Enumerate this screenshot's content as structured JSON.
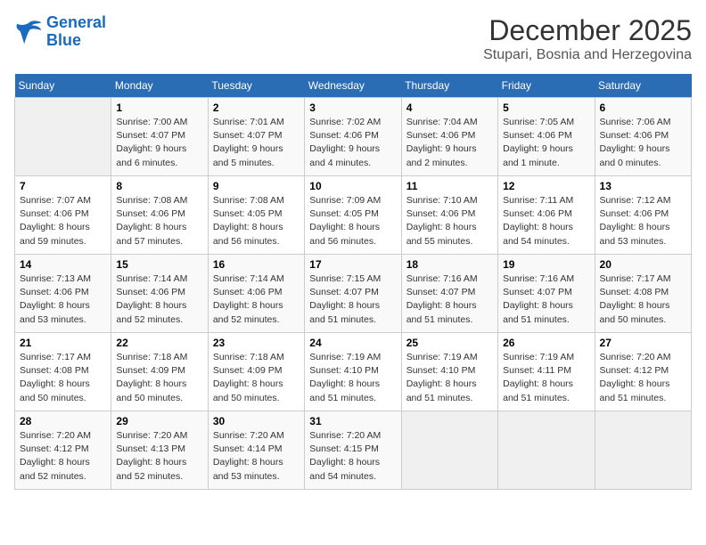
{
  "header": {
    "logo_line1": "General",
    "logo_line2": "Blue",
    "month_title": "December 2025",
    "location": "Stupari, Bosnia and Herzegovina"
  },
  "days_of_week": [
    "Sunday",
    "Monday",
    "Tuesday",
    "Wednesday",
    "Thursday",
    "Friday",
    "Saturday"
  ],
  "weeks": [
    [
      {
        "num": "",
        "empty": true
      },
      {
        "num": "1",
        "sunrise": "7:00 AM",
        "sunset": "4:07 PM",
        "daylight": "9 hours and 6 minutes."
      },
      {
        "num": "2",
        "sunrise": "7:01 AM",
        "sunset": "4:07 PM",
        "daylight": "9 hours and 5 minutes."
      },
      {
        "num": "3",
        "sunrise": "7:02 AM",
        "sunset": "4:06 PM",
        "daylight": "9 hours and 4 minutes."
      },
      {
        "num": "4",
        "sunrise": "7:04 AM",
        "sunset": "4:06 PM",
        "daylight": "9 hours and 2 minutes."
      },
      {
        "num": "5",
        "sunrise": "7:05 AM",
        "sunset": "4:06 PM",
        "daylight": "9 hours and 1 minute."
      },
      {
        "num": "6",
        "sunrise": "7:06 AM",
        "sunset": "4:06 PM",
        "daylight": "9 hours and 0 minutes."
      }
    ],
    [
      {
        "num": "7",
        "sunrise": "7:07 AM",
        "sunset": "4:06 PM",
        "daylight": "8 hours and 59 minutes."
      },
      {
        "num": "8",
        "sunrise": "7:08 AM",
        "sunset": "4:06 PM",
        "daylight": "8 hours and 57 minutes."
      },
      {
        "num": "9",
        "sunrise": "7:08 AM",
        "sunset": "4:05 PM",
        "daylight": "8 hours and 56 minutes."
      },
      {
        "num": "10",
        "sunrise": "7:09 AM",
        "sunset": "4:05 PM",
        "daylight": "8 hours and 56 minutes."
      },
      {
        "num": "11",
        "sunrise": "7:10 AM",
        "sunset": "4:06 PM",
        "daylight": "8 hours and 55 minutes."
      },
      {
        "num": "12",
        "sunrise": "7:11 AM",
        "sunset": "4:06 PM",
        "daylight": "8 hours and 54 minutes."
      },
      {
        "num": "13",
        "sunrise": "7:12 AM",
        "sunset": "4:06 PM",
        "daylight": "8 hours and 53 minutes."
      }
    ],
    [
      {
        "num": "14",
        "sunrise": "7:13 AM",
        "sunset": "4:06 PM",
        "daylight": "8 hours and 53 minutes."
      },
      {
        "num": "15",
        "sunrise": "7:14 AM",
        "sunset": "4:06 PM",
        "daylight": "8 hours and 52 minutes."
      },
      {
        "num": "16",
        "sunrise": "7:14 AM",
        "sunset": "4:06 PM",
        "daylight": "8 hours and 52 minutes."
      },
      {
        "num": "17",
        "sunrise": "7:15 AM",
        "sunset": "4:07 PM",
        "daylight": "8 hours and 51 minutes."
      },
      {
        "num": "18",
        "sunrise": "7:16 AM",
        "sunset": "4:07 PM",
        "daylight": "8 hours and 51 minutes."
      },
      {
        "num": "19",
        "sunrise": "7:16 AM",
        "sunset": "4:07 PM",
        "daylight": "8 hours and 51 minutes."
      },
      {
        "num": "20",
        "sunrise": "7:17 AM",
        "sunset": "4:08 PM",
        "daylight": "8 hours and 50 minutes."
      }
    ],
    [
      {
        "num": "21",
        "sunrise": "7:17 AM",
        "sunset": "4:08 PM",
        "daylight": "8 hours and 50 minutes."
      },
      {
        "num": "22",
        "sunrise": "7:18 AM",
        "sunset": "4:09 PM",
        "daylight": "8 hours and 50 minutes."
      },
      {
        "num": "23",
        "sunrise": "7:18 AM",
        "sunset": "4:09 PM",
        "daylight": "8 hours and 50 minutes."
      },
      {
        "num": "24",
        "sunrise": "7:19 AM",
        "sunset": "4:10 PM",
        "daylight": "8 hours and 51 minutes."
      },
      {
        "num": "25",
        "sunrise": "7:19 AM",
        "sunset": "4:10 PM",
        "daylight": "8 hours and 51 minutes."
      },
      {
        "num": "26",
        "sunrise": "7:19 AM",
        "sunset": "4:11 PM",
        "daylight": "8 hours and 51 minutes."
      },
      {
        "num": "27",
        "sunrise": "7:20 AM",
        "sunset": "4:12 PM",
        "daylight": "8 hours and 51 minutes."
      }
    ],
    [
      {
        "num": "28",
        "sunrise": "7:20 AM",
        "sunset": "4:12 PM",
        "daylight": "8 hours and 52 minutes."
      },
      {
        "num": "29",
        "sunrise": "7:20 AM",
        "sunset": "4:13 PM",
        "daylight": "8 hours and 52 minutes."
      },
      {
        "num": "30",
        "sunrise": "7:20 AM",
        "sunset": "4:14 PM",
        "daylight": "8 hours and 53 minutes."
      },
      {
        "num": "31",
        "sunrise": "7:20 AM",
        "sunset": "4:15 PM",
        "daylight": "8 hours and 54 minutes."
      },
      {
        "num": "",
        "empty": true
      },
      {
        "num": "",
        "empty": true
      },
      {
        "num": "",
        "empty": true
      }
    ]
  ],
  "labels": {
    "sunrise": "Sunrise:",
    "sunset": "Sunset:",
    "daylight": "Daylight:"
  }
}
